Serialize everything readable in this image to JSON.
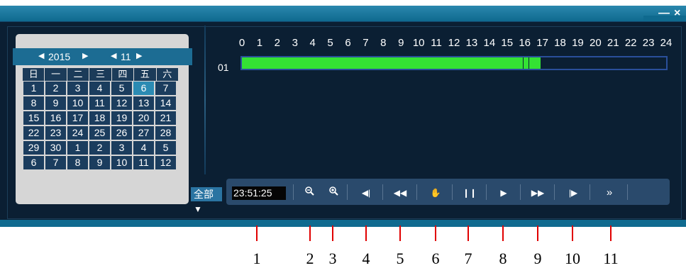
{
  "window": {
    "minimize": "—",
    "close": "×"
  },
  "calendar": {
    "year": "2015",
    "month": "11",
    "weekdays": [
      "日",
      "一",
      "二",
      "三",
      "四",
      "五",
      "六"
    ],
    "days": [
      "1",
      "2",
      "3",
      "4",
      "5",
      "6",
      "7",
      "8",
      "9",
      "10",
      "11",
      "12",
      "13",
      "14",
      "15",
      "16",
      "17",
      "18",
      "19",
      "20",
      "21",
      "22",
      "23",
      "24",
      "25",
      "26",
      "27",
      "28",
      "29",
      "30",
      "1",
      "2",
      "3",
      "4",
      "5",
      "6",
      "7",
      "8",
      "9",
      "10",
      "11",
      "12"
    ],
    "selected": "6"
  },
  "quanpu": "全部",
  "timeline": {
    "hours": [
      "0",
      "1",
      "2",
      "3",
      "4",
      "5",
      "6",
      "7",
      "8",
      "9",
      "10",
      "11",
      "12",
      "13",
      "14",
      "15",
      "16",
      "17",
      "18",
      "19",
      "20",
      "21",
      "22",
      "23",
      "24"
    ],
    "channel": "01",
    "recording_start_hour": 0,
    "recording_end_hour": 16.9,
    "cursor_hours": [
      15.9,
      16.2
    ]
  },
  "controls": {
    "time": "23:51:25"
  },
  "callouts": [
    "1",
    "2",
    "3",
    "4",
    "5",
    "6",
    "7",
    "8",
    "9",
    "10",
    "11"
  ],
  "colors": {
    "recording": "#34e234",
    "panel": "#0b1f33",
    "accent": "#0f6a8f",
    "callout_line": "#e00000"
  }
}
